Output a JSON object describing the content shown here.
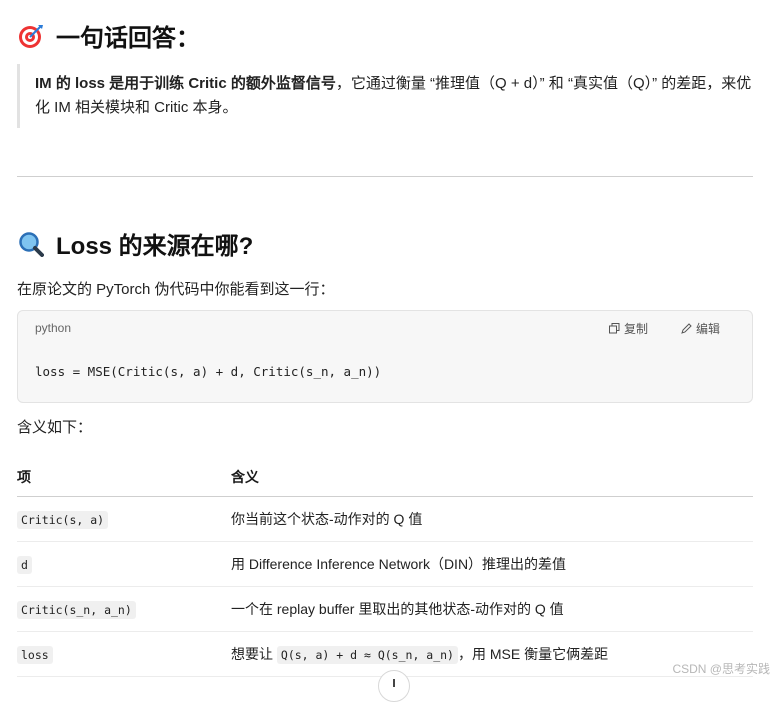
{
  "heading_answer": "一句话回答：",
  "quote": {
    "bold": "IM 的 loss 是用于训练 Critic 的额外监督信号",
    "rest": "，它通过衡量 “推理值（Q + d）” 和 “真实值（Q）” 的差距，来优化 IM 相关模块和 Critic 本身。"
  },
  "heading_loss": "Loss 的来源在哪?",
  "intro": "在原论文的 PyTorch 伪代码中你能看到这一行：",
  "code_block": {
    "lang": "python",
    "copy_label": "复制",
    "edit_label": "编辑",
    "code": "loss = MSE(Critic(s, a) + d, Critic(s_n, a_n))"
  },
  "meaning_label": "含义如下：",
  "table": {
    "headers": [
      "项",
      "含义"
    ],
    "rows": [
      {
        "item": "Critic(s, a)",
        "pre": "你当前这个状态-动作对的 Q 值",
        "code": "",
        "post": ""
      },
      {
        "item": "d",
        "pre": "用 Difference Inference Network（DIN）推理出的差值",
        "code": "",
        "post": ""
      },
      {
        "item": "Critic(s_n, a_n)",
        "pre": "一个在 replay buffer 里取出的其他状态-动作对的 Q 值",
        "code": "",
        "post": ""
      },
      {
        "item": "loss",
        "pre": "想要让 ",
        "code": "Q(s, a) + d ≈ Q(s_n, a_n)",
        "post": "，用 MSE 衡量它俩差距"
      }
    ]
  },
  "watermark": "CSDN @思考实践",
  "icons": {
    "answer": "target-icon",
    "loss": "magnifier-icon",
    "copy": "copy-icon",
    "edit": "pencil-icon"
  }
}
